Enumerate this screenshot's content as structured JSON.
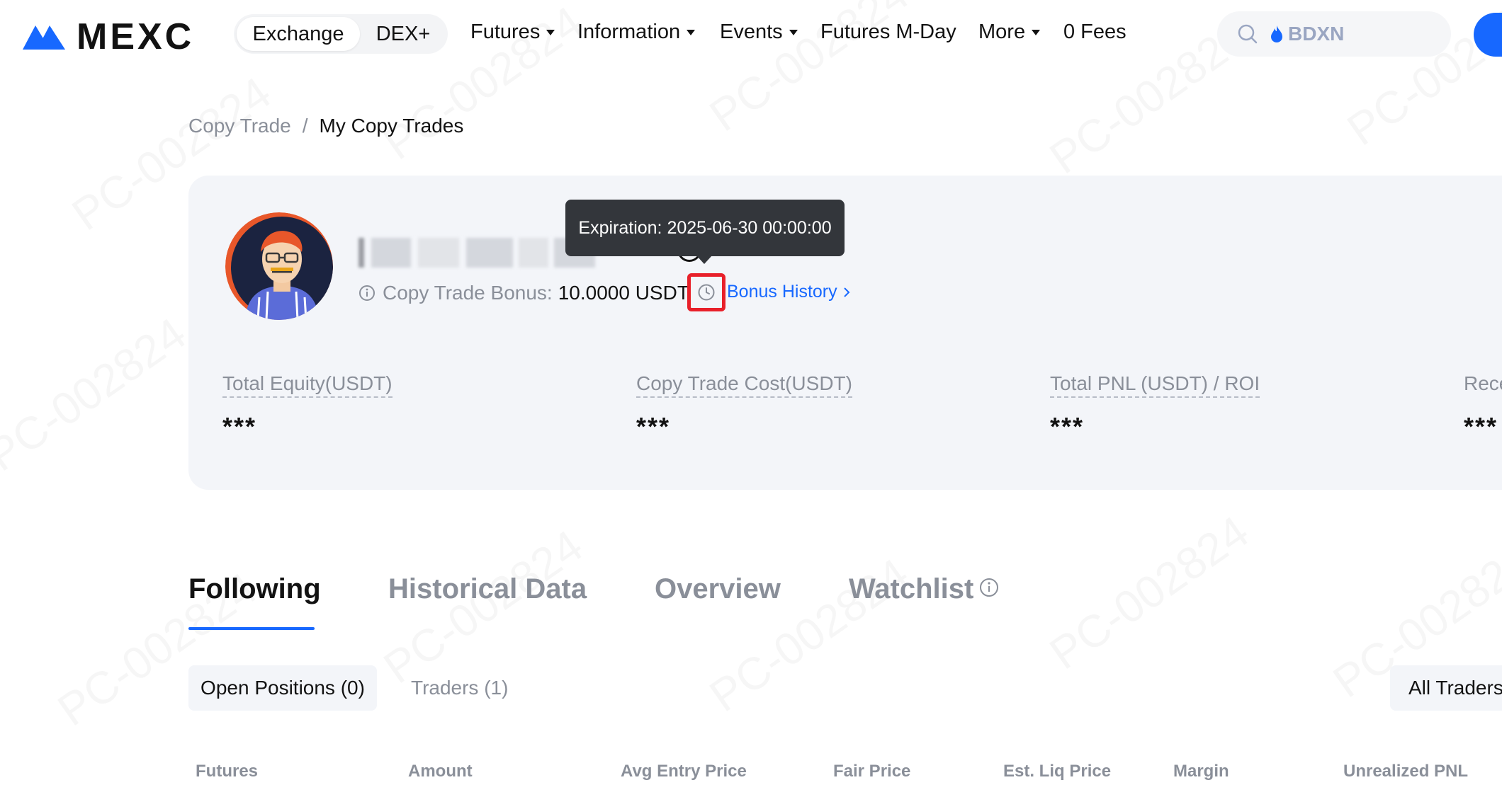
{
  "header": {
    "brand": "MEXC",
    "segment": {
      "exchange": "Exchange",
      "dex": "DEX+"
    },
    "nav": [
      {
        "label": "Futures",
        "dropdown": true
      },
      {
        "label": "Information",
        "dropdown": true
      },
      {
        "label": "Events",
        "dropdown": true
      },
      {
        "label": "Futures M-Day",
        "dropdown": false
      },
      {
        "label": "More",
        "dropdown": true
      },
      {
        "label": "0 Fees",
        "dropdown": false
      }
    ],
    "search": {
      "value": "BDXN",
      "icon": "search-icon",
      "badge_icon": "flame-icon"
    }
  },
  "breadcrumb": {
    "parent": "Copy Trade",
    "separator": "/",
    "current": "My Copy Trades"
  },
  "profile": {
    "name_visible_tail": "k.com",
    "bonus_label": "Copy Trade Bonus:",
    "bonus_value": "10.0000 USDT",
    "bonus_history": "Bonus History",
    "tooltip": "Expiration: 2025-06-30 00:00:00",
    "stats": [
      {
        "label": "Total Equity(USDT)",
        "value": "***"
      },
      {
        "label": "Copy Trade Cost(USDT)",
        "value": "***"
      },
      {
        "label": "Total PNL (USDT) / ROI",
        "value": "***"
      },
      {
        "label": "Rece",
        "value": "***"
      }
    ]
  },
  "tabs": [
    "Following",
    "Historical Data",
    "Overview",
    "Watchlist"
  ],
  "subtabs": {
    "open_positions": "Open Positions (0)",
    "traders": "Traders (1)",
    "filter": "All Traders"
  },
  "table_headers": [
    "Futures",
    "Amount",
    "Avg Entry Price",
    "Fair Price",
    "Est. Liq Price",
    "Margin",
    "Unrealized PNL"
  ],
  "colors": {
    "accent": "#1768ff",
    "highlight": "#e8202a",
    "card_bg": "#f3f5f9",
    "muted": "#8a8f99",
    "tooltip_bg": "#33363b"
  },
  "watermark": "PC-002824"
}
